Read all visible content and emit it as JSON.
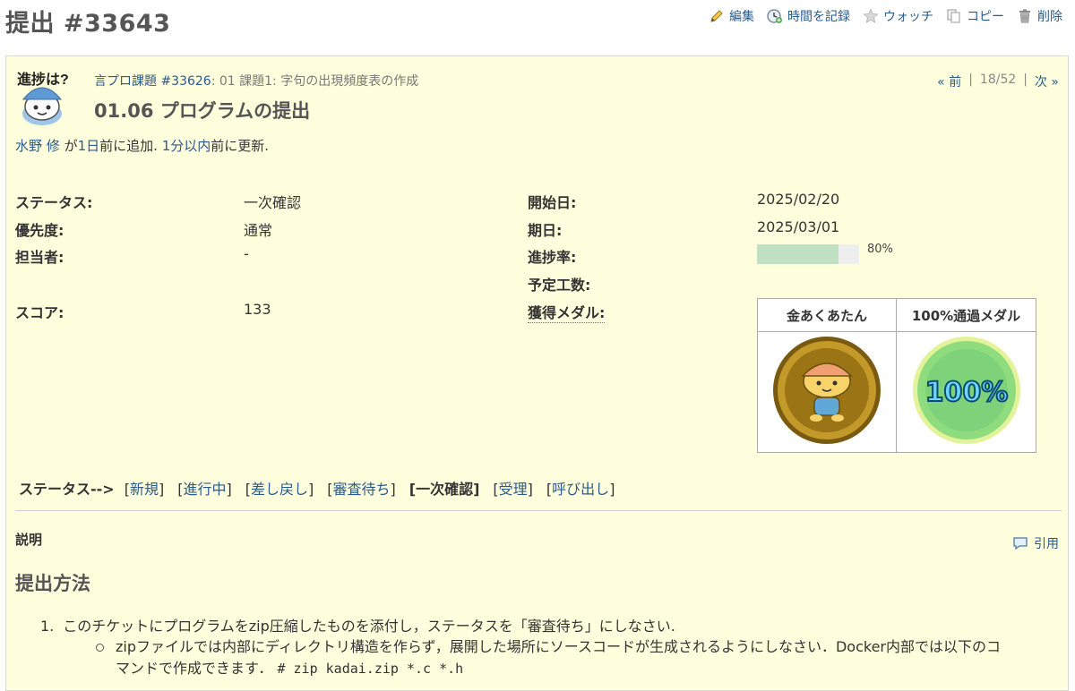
{
  "page": {
    "title": "提出 #33643"
  },
  "actions": {
    "edit": "編集",
    "log_time": "時間を記録",
    "watch": "ウォッチ",
    "copy": "コピー",
    "delete": "削除"
  },
  "issue": {
    "parent_link": "言プロ課題 #33626",
    "parent_rest": ": 01 課題1: 字句の出現頻度表の作成",
    "subject": "01.06 プログラムの提出",
    "avatar_text": "進捗は?",
    "pager": {
      "prev": "« 前",
      "sep1": "|",
      "position": "18/52",
      "sep2": "|",
      "next": "次 »"
    },
    "author": {
      "name": "水野 修",
      "ga": "が",
      "added_ago": "1日",
      "added_suffix": "前に追加.",
      "updated_ago": "1分以内",
      "updated_suffix": "前に更新."
    }
  },
  "attributes": {
    "status_label": "ステータス:",
    "status_value": "一次確認",
    "priority_label": "優先度:",
    "priority_value": "通常",
    "assignee_label": "担当者:",
    "assignee_value": "-",
    "score_label": "スコア:",
    "score_value": "133",
    "start_label": "開始日:",
    "start_value": "2025/02/20",
    "due_label": "期日:",
    "due_value": "2025/03/01",
    "progress_label": "進捗率:",
    "progress_text": "80%",
    "progress_value": 80,
    "estimated_label": "予定工数:",
    "medals_label": "獲得メダル:"
  },
  "medals": {
    "gold_name": "金あくあたん",
    "pass_name": "100%通過メダル",
    "pass_badge_text": "100%"
  },
  "status_bar": {
    "label": "ステータス-->",
    "items": [
      "新規",
      "進行中",
      "差し戻し",
      "審査待ち",
      "一次確認",
      "受理",
      "呼び出し"
    ],
    "current": "一次確認"
  },
  "description": {
    "label": "説明",
    "quote": "引用",
    "heading": "提出方法",
    "item1_num": "1.",
    "item1": "このチケットにプログラムをzip圧縮したものを添付し，ステータスを「審査待ち」にしなさい.",
    "sub1_line1": "zipファイルでは内部にディレクトリ構造を作らず，展開した場所にソースコードが生成されるようにしなさい．Docker内部では以下のコ",
    "sub1_line2_text": "マンドで作成できます．",
    "sub1_code": "# zip kadai.zip *.c *.h"
  },
  "colors": {
    "link": "#2a5a8a",
    "issue_bg": "#ffffdd",
    "progress_fill": "#bfe0c3",
    "medal_gold": "#b8901a",
    "medal_green": "#7fd87a"
  }
}
